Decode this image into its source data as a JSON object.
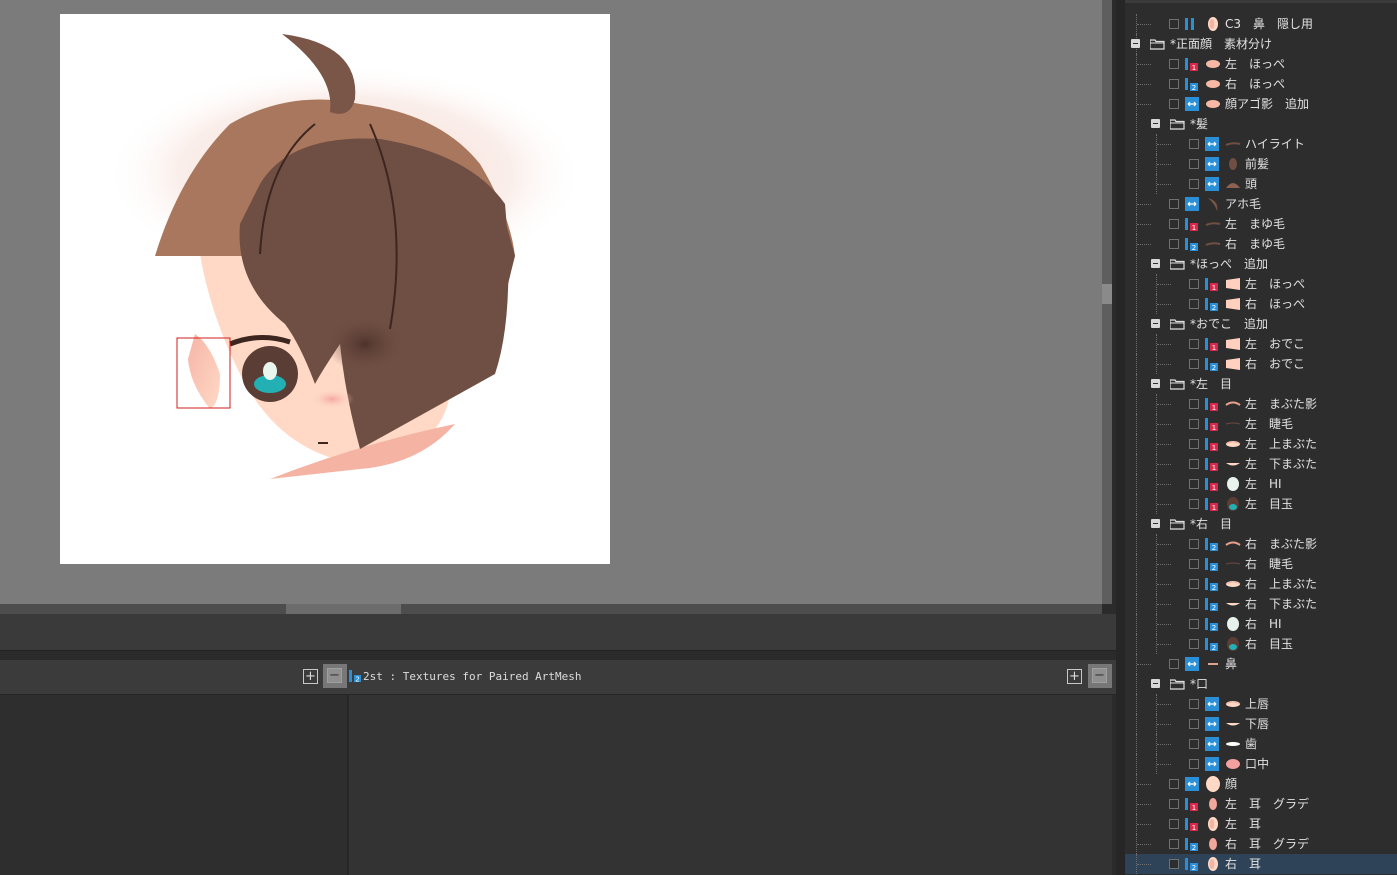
{
  "editor": {
    "texture_label": "2st : Textures for Paired ArtMesh",
    "expand_icon": "plus-icon",
    "collapse_icon": "minus-icon"
  },
  "colors": {
    "canvas_bg": "#7b7b7b",
    "panel_bg": "#2d2d2d",
    "selected_row": "#2f4358",
    "link_blue": "#2a8fd6",
    "pair_red": "#d8284b",
    "hair_dark": "#6f4e43",
    "hair_light": "#a8775d",
    "skin": "#ffd9c6",
    "eye_teal": "#22b0b4"
  },
  "layers": [
    {
      "label": "C3　鼻　隠し用",
      "depth": 1,
      "kind": "mesh",
      "mode": "pair",
      "pair": "",
      "thumb": "ear"
    },
    {
      "label": "*正面顔　素材分け",
      "depth": 0,
      "kind": "folder"
    },
    {
      "label": "左　ほっぺ",
      "depth": 1,
      "kind": "mesh",
      "mode": "pair",
      "pair": "1",
      "thumb": "cheek"
    },
    {
      "label": "右　ほっぺ",
      "depth": 1,
      "kind": "mesh",
      "mode": "pair",
      "pair": "2",
      "thumb": "cheek"
    },
    {
      "label": "顔アゴ影　追加",
      "depth": 1,
      "kind": "mesh",
      "mode": "link",
      "thumb": "cheek"
    },
    {
      "label": "*髪",
      "depth": 1,
      "kind": "folder"
    },
    {
      "label": "ハイライト",
      "depth": 2,
      "kind": "mesh",
      "mode": "link",
      "thumb": "brow"
    },
    {
      "label": "前髪",
      "depth": 2,
      "kind": "mesh",
      "mode": "link",
      "thumb": "hairfront"
    },
    {
      "label": "頭",
      "depth": 2,
      "kind": "mesh",
      "mode": "link",
      "thumb": "head"
    },
    {
      "label": "アホ毛",
      "depth": 1,
      "kind": "mesh",
      "mode": "link",
      "thumb": "ahoge"
    },
    {
      "label": "左　まゆ毛",
      "depth": 1,
      "kind": "mesh",
      "mode": "pair",
      "pair": "1",
      "thumb": "brow"
    },
    {
      "label": "右　まゆ毛",
      "depth": 1,
      "kind": "mesh",
      "mode": "pair",
      "pair": "2",
      "thumb": "brow"
    },
    {
      "label": "*ほっぺ　追加",
      "depth": 1,
      "kind": "folder"
    },
    {
      "label": "左　ほっぺ",
      "depth": 2,
      "kind": "mesh",
      "mode": "pair",
      "pair": "1",
      "thumb": "wedge"
    },
    {
      "label": "右　ほっぺ",
      "depth": 2,
      "kind": "mesh",
      "mode": "pair",
      "pair": "2",
      "thumb": "wedge"
    },
    {
      "label": "*おでこ　追加",
      "depth": 1,
      "kind": "folder"
    },
    {
      "label": "左　おでこ",
      "depth": 2,
      "kind": "mesh",
      "mode": "pair",
      "pair": "1",
      "thumb": "wedge"
    },
    {
      "label": "右　おでこ",
      "depth": 2,
      "kind": "mesh",
      "mode": "pair",
      "pair": "2",
      "thumb": "wedge"
    },
    {
      "label": "*左　目",
      "depth": 1,
      "kind": "folder"
    },
    {
      "label": "左　まぶた影",
      "depth": 2,
      "kind": "mesh",
      "mode": "pair",
      "pair": "1",
      "thumb": "lidshadow"
    },
    {
      "label": "左　睫毛",
      "depth": 2,
      "kind": "mesh",
      "mode": "pair",
      "pair": "1",
      "thumb": "lash"
    },
    {
      "label": "左　上まぶた",
      "depth": 2,
      "kind": "mesh",
      "mode": "pair",
      "pair": "1",
      "thumb": "lid"
    },
    {
      "label": "左　下まぶた",
      "depth": 2,
      "kind": "mesh",
      "mode": "pair",
      "pair": "1",
      "thumb": "lowlid"
    },
    {
      "label": "左　HI",
      "depth": 2,
      "kind": "mesh",
      "mode": "pair",
      "pair": "1",
      "thumb": "hi"
    },
    {
      "label": "左　目玉",
      "depth": 2,
      "kind": "mesh",
      "mode": "pair",
      "pair": "1",
      "thumb": "eyeball"
    },
    {
      "label": "*右　目",
      "depth": 1,
      "kind": "folder"
    },
    {
      "label": "右　まぶた影",
      "depth": 2,
      "kind": "mesh",
      "mode": "pair",
      "pair": "2",
      "thumb": "lidshadow"
    },
    {
      "label": "右　睫毛",
      "depth": 2,
      "kind": "mesh",
      "mode": "pair",
      "pair": "2",
      "thumb": "lash"
    },
    {
      "label": "右　上まぶた",
      "depth": 2,
      "kind": "mesh",
      "mode": "pair",
      "pair": "2",
      "thumb": "lid"
    },
    {
      "label": "右　下まぶた",
      "depth": 2,
      "kind": "mesh",
      "mode": "pair",
      "pair": "2",
      "thumb": "lowlid"
    },
    {
      "label": "右　HI",
      "depth": 2,
      "kind": "mesh",
      "mode": "pair",
      "pair": "2",
      "thumb": "hi"
    },
    {
      "label": "右　目玉",
      "depth": 2,
      "kind": "mesh",
      "mode": "pair",
      "pair": "2",
      "thumb": "eyeball"
    },
    {
      "label": "鼻",
      "depth": 1,
      "kind": "mesh",
      "mode": "link",
      "thumb": "nose"
    },
    {
      "label": "*口",
      "depth": 1,
      "kind": "folder"
    },
    {
      "label": "上唇",
      "depth": 2,
      "kind": "mesh",
      "mode": "link",
      "thumb": "lid"
    },
    {
      "label": "下唇",
      "depth": 2,
      "kind": "mesh",
      "mode": "link",
      "thumb": "lowlid"
    },
    {
      "label": "歯",
      "depth": 2,
      "kind": "mesh",
      "mode": "link",
      "thumb": "teeth"
    },
    {
      "label": "口中",
      "depth": 2,
      "kind": "mesh",
      "mode": "link",
      "thumb": "mouth"
    },
    {
      "label": "顔",
      "depth": 1,
      "kind": "mesh",
      "mode": "link",
      "thumb": "face"
    },
    {
      "label": "左　耳　グラデ",
      "depth": 1,
      "kind": "mesh",
      "mode": "pair",
      "pair": "1",
      "thumb": "eargrad"
    },
    {
      "label": "左　耳",
      "depth": 1,
      "kind": "mesh",
      "mode": "pair",
      "pair": "1",
      "thumb": "ear"
    },
    {
      "label": "右　耳　グラデ",
      "depth": 1,
      "kind": "mesh",
      "mode": "pair",
      "pair": "2",
      "thumb": "eargrad"
    },
    {
      "label": "右　耳",
      "depth": 1,
      "kind": "mesh",
      "mode": "pair",
      "pair": "2",
      "thumb": "ear",
      "selected": true
    }
  ]
}
